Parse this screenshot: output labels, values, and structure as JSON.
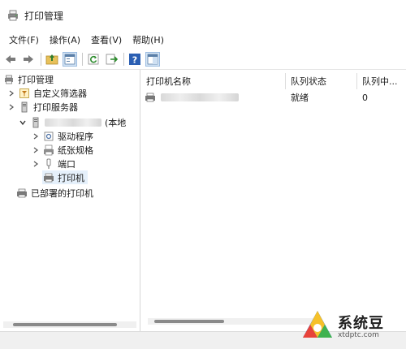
{
  "window": {
    "title": "打印管理"
  },
  "menu": [
    "文件(F)",
    "操作(A)",
    "查看(V)",
    "帮助(H)"
  ],
  "toolbar": {
    "icons": [
      "back-arrow-icon",
      "forward-arrow-icon",
      "up-folder-icon",
      "show-tree-icon",
      "refresh-icon",
      "export-icon",
      "help-icon",
      "properties-icon"
    ]
  },
  "tree": {
    "root": "打印管理",
    "custom_filters": "自定义筛选器",
    "print_servers": "打印服务器",
    "server_suffix": "(本地",
    "drivers": "驱动程序",
    "forms": "纸张规格",
    "ports": "端口",
    "printers": "打印机",
    "deployed_printers": "已部署的打印机"
  },
  "table": {
    "columns": [
      "打印机名称",
      "队列状态",
      "队列中..."
    ],
    "rows": [
      {
        "name": "",
        "status": "就绪",
        "jobs": "0"
      }
    ]
  },
  "watermark": {
    "title": "系统豆",
    "url": "xtdptc.com"
  }
}
